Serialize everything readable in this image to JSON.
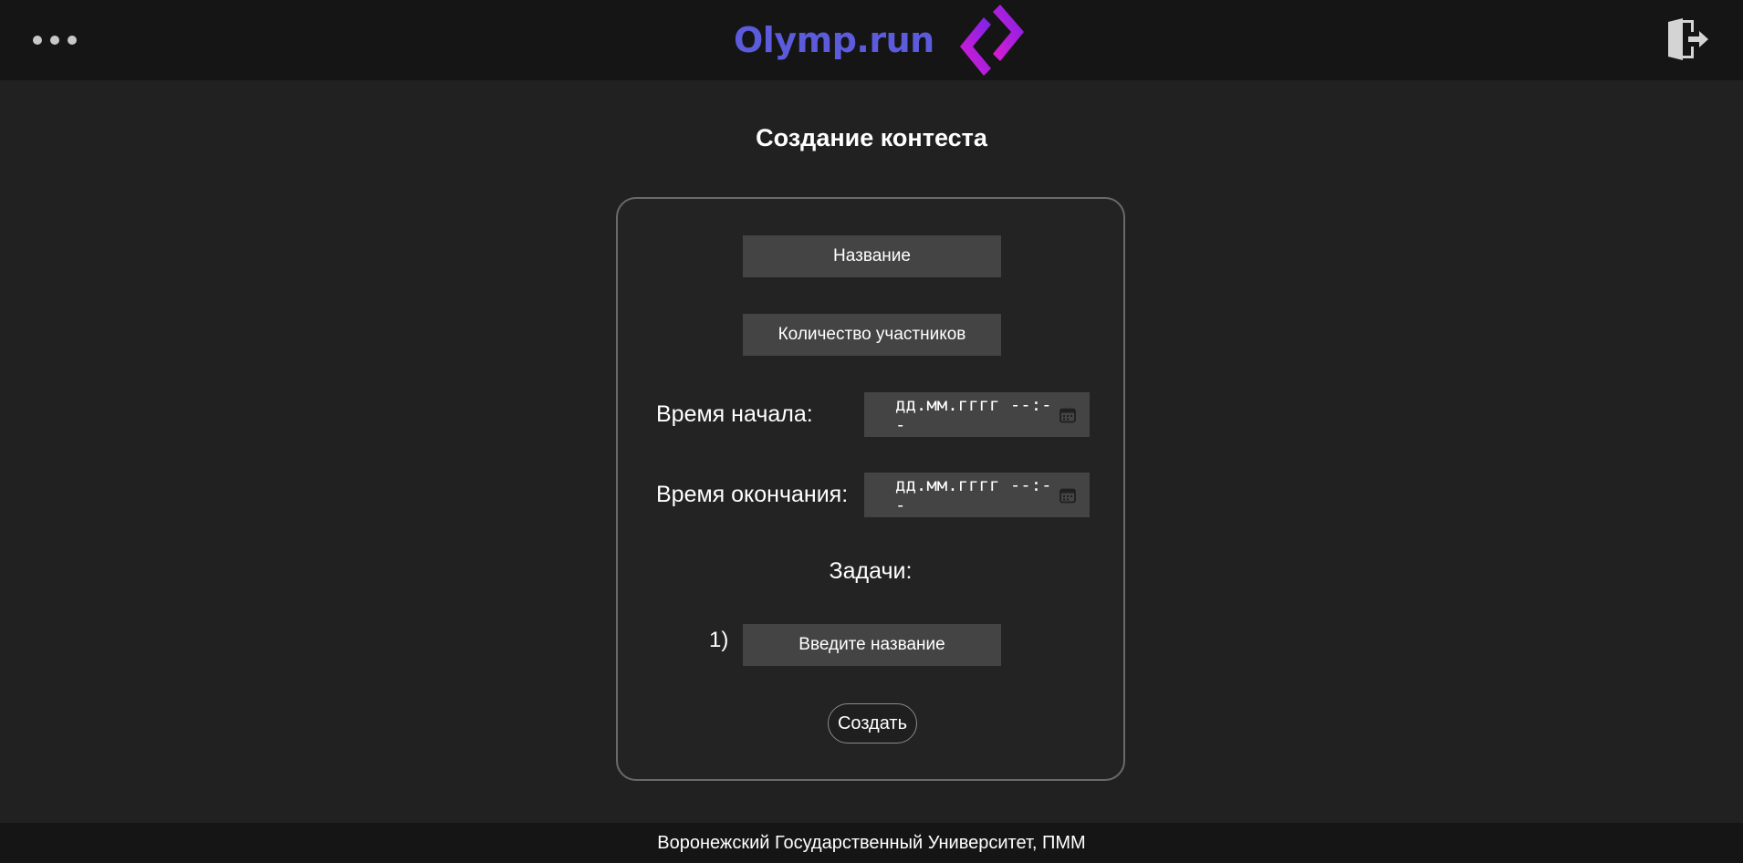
{
  "header": {
    "brand": "Olymp.run",
    "menu_icon": "more-horizontal-icon",
    "logout_icon": "logout-door-icon"
  },
  "page": {
    "title": "Создание контеста"
  },
  "form": {
    "name_placeholder": "Название",
    "participants_placeholder": "Количество участников",
    "start_label": "Время начала:",
    "start_value": "дд.мм.гггг --:--",
    "end_label": "Время окончания:",
    "end_value": "дд.мм.гггг --:--",
    "calendar_icon": "calendar-icon",
    "tasks_label": "Задачи:",
    "tasks": [
      {
        "number": "1)",
        "placeholder": "Введите название"
      }
    ],
    "submit_label": "Создать"
  },
  "footer": {
    "text": "Воронежский Государственный Университет, ПММ"
  },
  "colors": {
    "background": "#212121",
    "header_bg": "#151515",
    "brand": "#5b5bdb",
    "logo_magenta": "#d419d4",
    "logo_purple": "#7a24e8",
    "input_bg": "#444444",
    "card_border": "#6a6a6a"
  }
}
